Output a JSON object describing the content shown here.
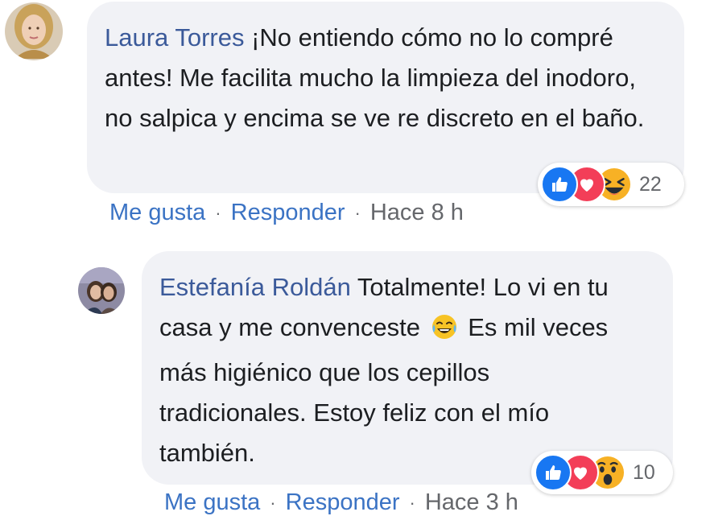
{
  "comments": [
    {
      "author": "Laura Torres",
      "text": "¡No entiendo cómo no lo compré antes! Me facilita mucho la limpieza del inodoro, no salpica y encima se ve re discreto en el baño.",
      "reaction_icons": [
        "like-icon",
        "love-icon",
        "haha-icon"
      ],
      "reaction_count": "22",
      "like_label": "Me gusta",
      "reply_label": "Responder",
      "time": "Hace 8 h",
      "separator": "·"
    },
    {
      "author": "Estefanía Roldán",
      "text_before_emoji": "Totalmente! Lo vi en tu casa y me convenceste",
      "inline_emoji": "tears-of-joy-emoji",
      "text_after_emoji": "Es mil veces más higiénico que los cepillos tradicionales. Estoy feliz con el mío también.",
      "reaction_icons": [
        "like-icon",
        "love-icon",
        "wow-icon"
      ],
      "reaction_count": "10",
      "like_label": "Me gusta",
      "reply_label": "Responder",
      "time": "Hace 3 h",
      "separator": "·"
    }
  ],
  "colors": {
    "author": "#3b5a9a",
    "link": "#3b73c4",
    "muted": "#65676b",
    "bubble": "#f1f2f6",
    "like": "#1877f2",
    "love": "#f33e58"
  }
}
